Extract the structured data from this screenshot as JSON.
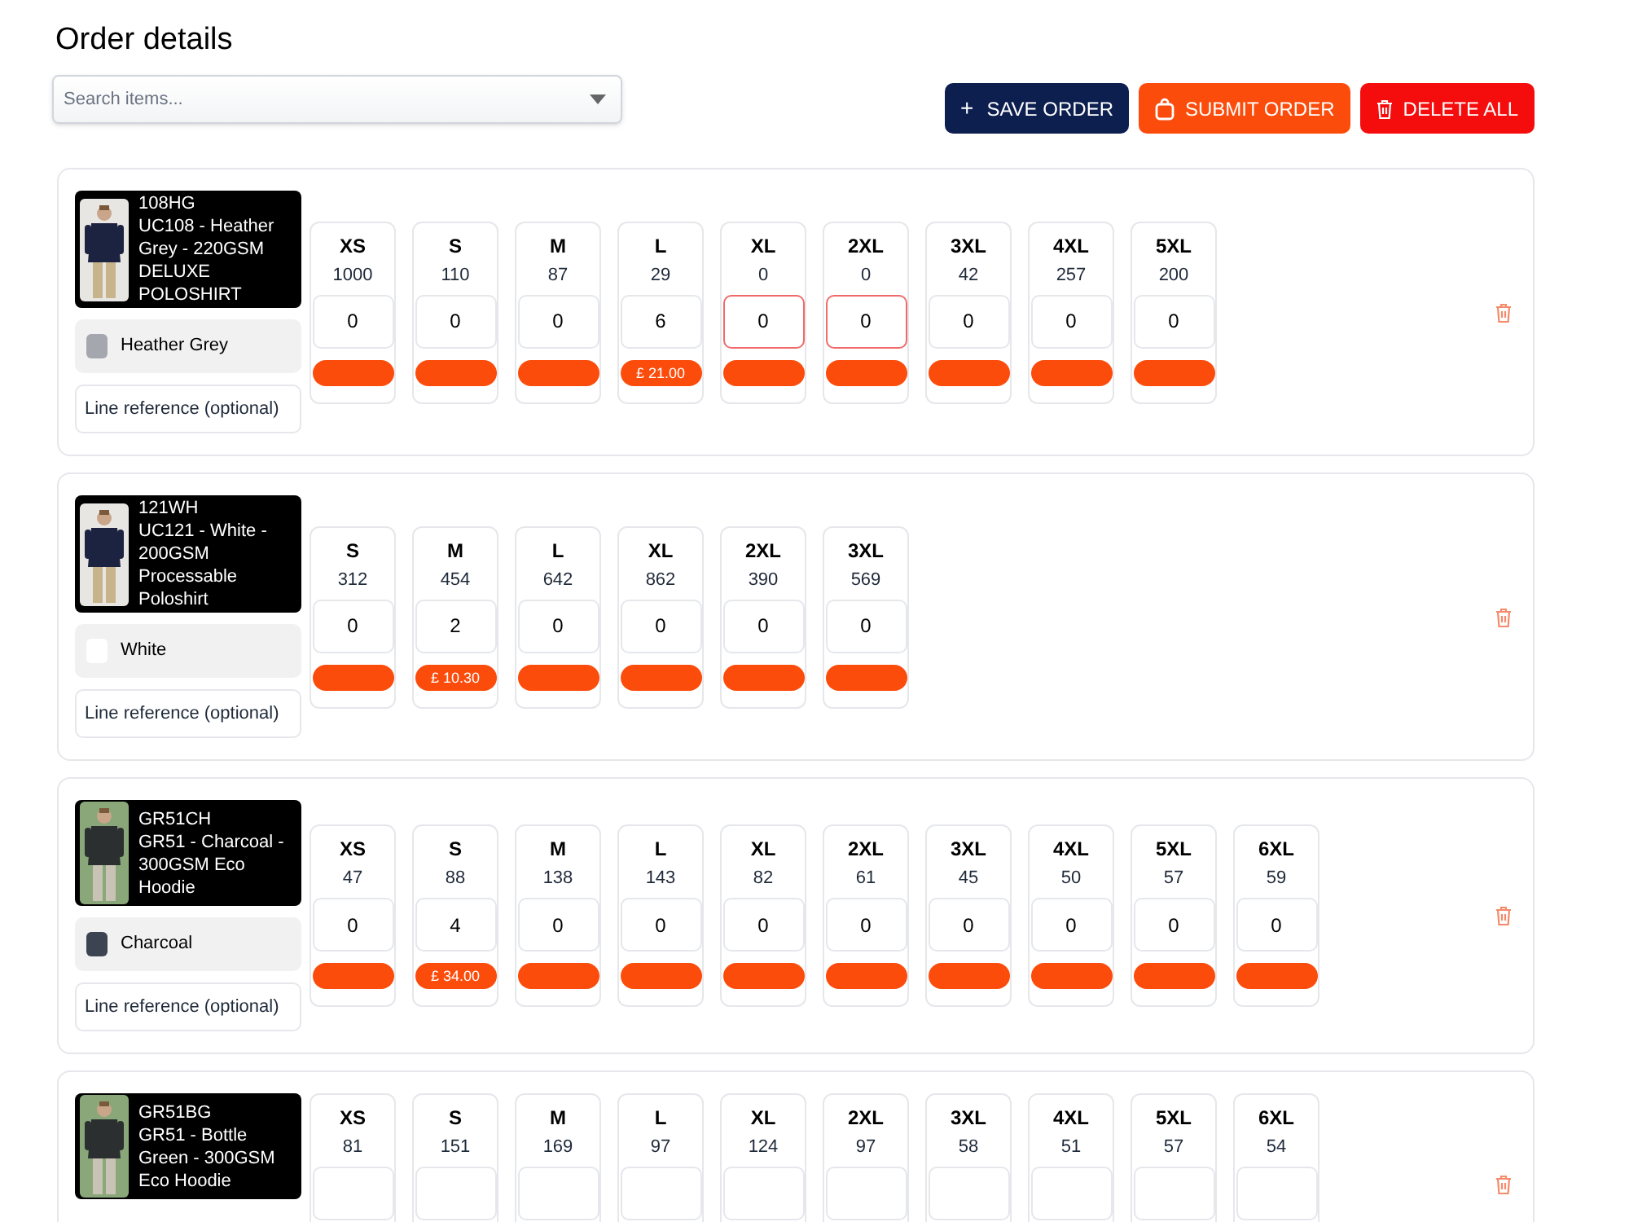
{
  "title": "Order details",
  "search": {
    "placeholder": "Search items..."
  },
  "buttons": [
    {
      "kind": "save",
      "icon": "+",
      "label": "SAVE ORDER"
    },
    {
      "kind": "submit",
      "label": "SUBMIT ORDER"
    },
    {
      "kind": "delete",
      "label": "DELETE ALL"
    }
  ],
  "lines": [
    {
      "code": "108HG",
      "name": "UC108 - Heather Grey - 220GSM DELUXE POLOSHIRT",
      "colour": {
        "name": "Heather Grey",
        "color": "#a4a7ad"
      },
      "line_reference": {
        "placeholder": "Line reference (optional)"
      },
      "sizes": [
        {
          "size": "XS",
          "stock": "1000",
          "qty": "0",
          "invalid": false
        },
        {
          "size": "S",
          "stock": "110",
          "qty": "0",
          "invalid": false
        },
        {
          "size": "M",
          "stock": "87",
          "qty": "0",
          "invalid": false
        },
        {
          "size": "L",
          "stock": "29",
          "qty": "6",
          "invalid": false,
          "price": "£ 21.00"
        },
        {
          "size": "XL",
          "stock": "0",
          "qty": "0",
          "invalid": true
        },
        {
          "size": "2XL",
          "stock": "0",
          "qty": "0",
          "invalid": true
        },
        {
          "size": "3XL",
          "stock": "42",
          "qty": "0",
          "invalid": false
        },
        {
          "size": "4XL",
          "stock": "257",
          "qty": "0",
          "invalid": false
        },
        {
          "size": "5XL",
          "stock": "200",
          "qty": "0",
          "invalid": false
        }
      ]
    },
    {
      "code": "121WH",
      "name": "UC121 - White - 200GSM Processable Poloshirt",
      "colour": {
        "name": "White",
        "color": "#ffffff"
      },
      "line_reference": {
        "placeholder": "Line reference (optional)"
      },
      "sizes": [
        {
          "size": "S",
          "stock": "312",
          "qty": "0",
          "invalid": false
        },
        {
          "size": "M",
          "stock": "454",
          "qty": "2",
          "invalid": false,
          "price": "£ 10.30"
        },
        {
          "size": "L",
          "stock": "642",
          "qty": "0",
          "invalid": false
        },
        {
          "size": "XL",
          "stock": "862",
          "qty": "0",
          "invalid": false
        },
        {
          "size": "2XL",
          "stock": "390",
          "qty": "0",
          "invalid": false
        },
        {
          "size": "3XL",
          "stock": "569",
          "qty": "0",
          "invalid": false
        }
      ]
    },
    {
      "code": "GR51CH",
      "name": "GR51 - Charcoal - 300GSM Eco Hoodie",
      "colour": {
        "name": "Charcoal",
        "color": "#3d4451"
      },
      "line_reference": {
        "placeholder": "Line reference (optional)"
      },
      "sizes": [
        {
          "size": "XS",
          "stock": "47",
          "qty": "0",
          "invalid": false
        },
        {
          "size": "S",
          "stock": "88",
          "qty": "4",
          "invalid": false,
          "price": "£ 34.00"
        },
        {
          "size": "M",
          "stock": "138",
          "qty": "0",
          "invalid": false
        },
        {
          "size": "L",
          "stock": "143",
          "qty": "0",
          "invalid": false
        },
        {
          "size": "XL",
          "stock": "82",
          "qty": "0",
          "invalid": false
        },
        {
          "size": "2XL",
          "stock": "61",
          "qty": "0",
          "invalid": false
        },
        {
          "size": "3XL",
          "stock": "45",
          "qty": "0",
          "invalid": false
        },
        {
          "size": "4XL",
          "stock": "50",
          "qty": "0",
          "invalid": false
        },
        {
          "size": "5XL",
          "stock": "57",
          "qty": "0",
          "invalid": false
        },
        {
          "size": "6XL",
          "stock": "59",
          "qty": "0",
          "invalid": false
        }
      ]
    },
    {
      "code": "GR51BG",
      "name": "GR51 - Bottle Green - 300GSM Eco Hoodie",
      "sizes": [
        {
          "size": "XS",
          "stock": "81",
          "invalid": false
        },
        {
          "size": "S",
          "stock": "151",
          "invalid": false
        },
        {
          "size": "M",
          "stock": "169",
          "invalid": false
        },
        {
          "size": "L",
          "stock": "97",
          "invalid": false
        },
        {
          "size": "XL",
          "stock": "124",
          "invalid": false
        },
        {
          "size": "2XL",
          "stock": "97",
          "invalid": false
        },
        {
          "size": "3XL",
          "stock": "58",
          "invalid": false
        },
        {
          "size": "4XL",
          "stock": "51",
          "invalid": false
        },
        {
          "size": "5XL",
          "stock": "57",
          "invalid": false
        },
        {
          "size": "6XL",
          "stock": "54",
          "invalid": false
        }
      ]
    }
  ]
}
